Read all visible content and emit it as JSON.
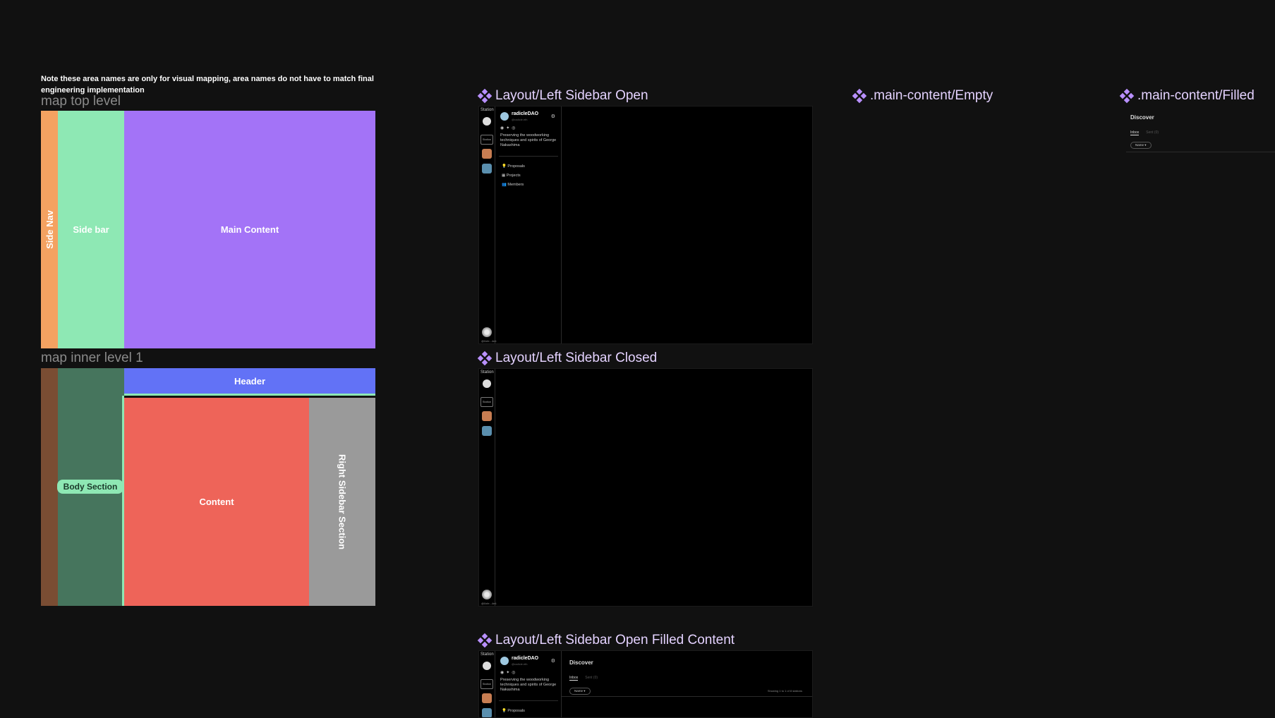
{
  "note": "Note these area names are only for visual mapping, area names do not have to match final engineering implementation",
  "map_top": {
    "label": "map top level",
    "side_nav": "Side Nav",
    "side_bar": "Side bar",
    "main_content": "Main Content",
    "colors": {
      "side_nav": "#f4a261",
      "side_bar": "#8ee8b4",
      "main_content": "#a373f7"
    }
  },
  "map_inner": {
    "label": "map inner level 1",
    "header": "Header",
    "body_section": "Body Section",
    "content": "Content",
    "right_sidebar": "Right Sidebar Section",
    "colors": {
      "nav": "#7a4d33",
      "body": "#46755d",
      "header": "#6272f6",
      "content": "#ee6459",
      "right": "#9a9a9a",
      "accent": "#8ee8b4"
    }
  },
  "frames": {
    "sidebar_open": {
      "title": "Layout/Left Sidebar Open"
    },
    "sidebar_closed": {
      "title": "Layout/Left Sidebar Closed"
    },
    "sidebar_open_filled": {
      "title": "Layout/Left Sidebar Open Filled Content"
    },
    "main_empty": {
      "title": ".main-content/Empty"
    },
    "main_filled": {
      "title": ".main-content/Filled"
    }
  },
  "app": {
    "rail_label": "Station",
    "rail_active_label": "Station",
    "rail_footer": "@0xfe...4e4",
    "org_name": "radicleDAO",
    "org_handle": "@radicle.eth",
    "org_description": "Preserving the woodworking techniques and spirits of George Nakashima",
    "nav": [
      "Proposals",
      "Projects",
      "Members"
    ],
    "colors": {
      "accent": "#b990ff",
      "avatar": "#9ec8e0"
    }
  },
  "main_content": {
    "title": "Discover",
    "tabs": [
      "Inbox",
      "Sent (0)"
    ],
    "filter": "Name ▾",
    "pagination": "Showing 1 to 1 of 8 stations"
  }
}
